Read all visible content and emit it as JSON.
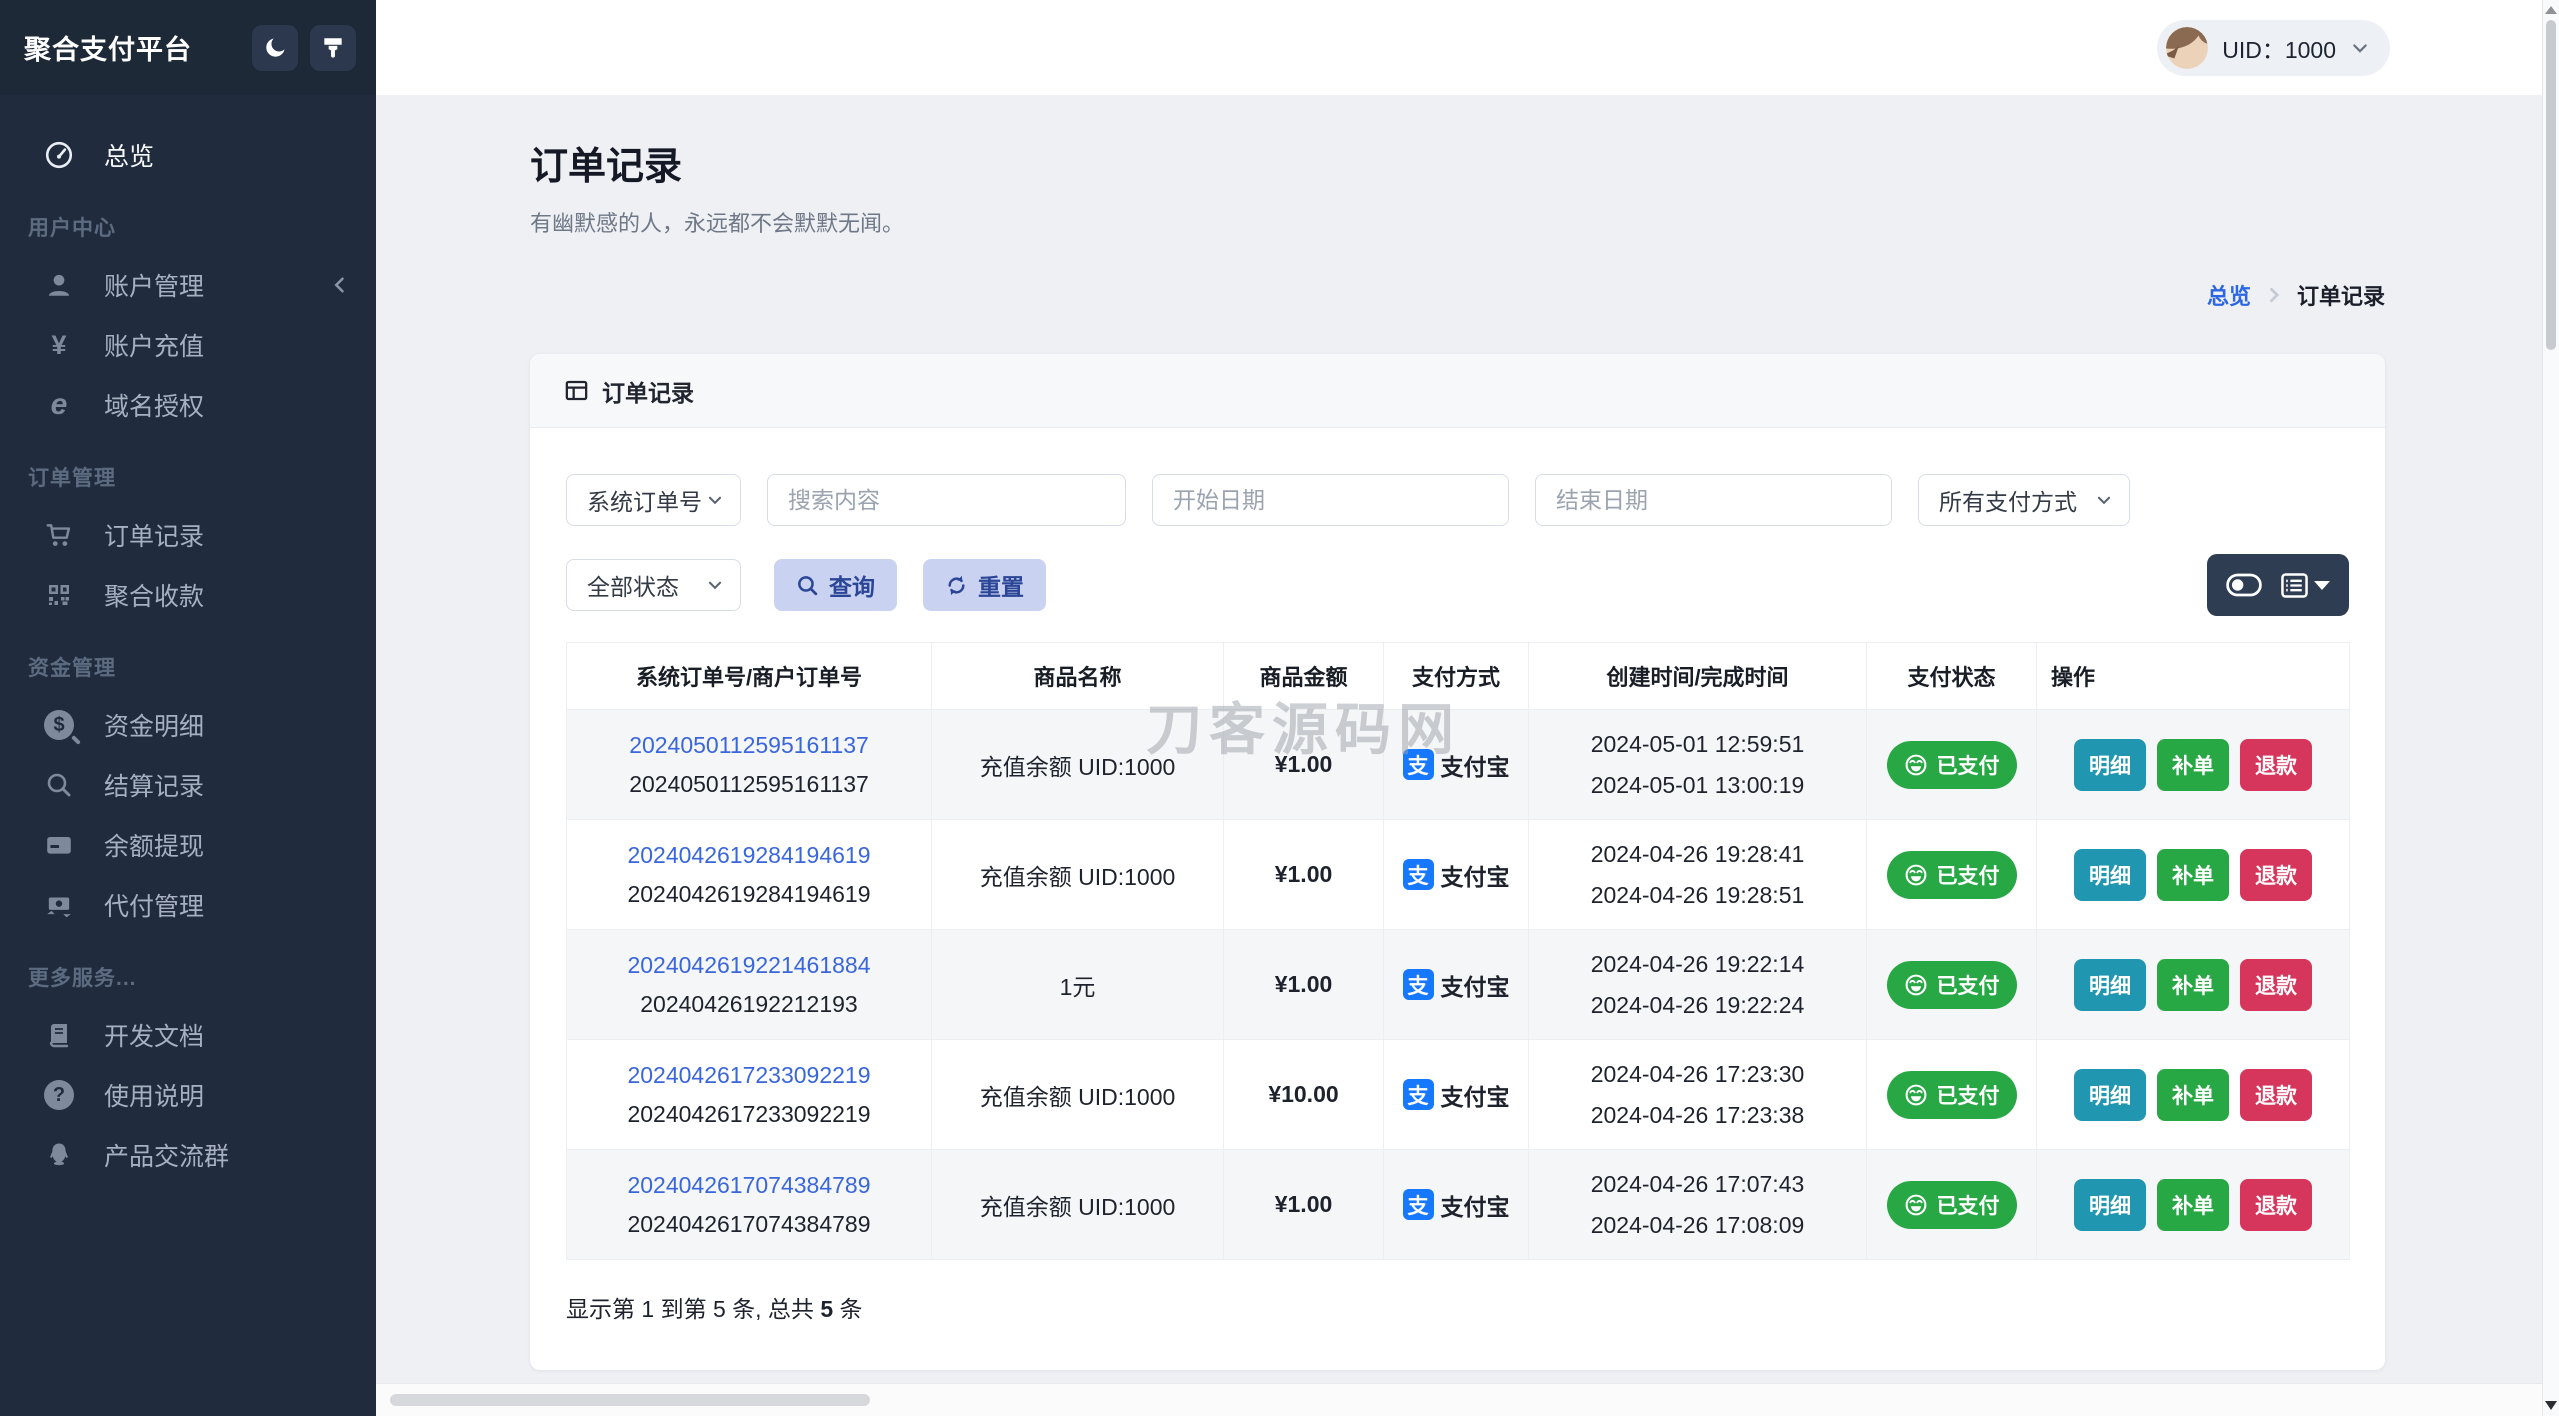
{
  "sidebar": {
    "logo": "聚合支付平台",
    "sections": [
      {
        "label": "",
        "items": [
          {
            "label": "总览",
            "icon": "dashboard-icon",
            "active": true
          }
        ]
      },
      {
        "label": "用户中心",
        "items": [
          {
            "label": "账户管理",
            "icon": "user-icon",
            "has_submenu": true
          },
          {
            "label": "账户充值",
            "icon": "yen-icon"
          },
          {
            "label": "域名授权",
            "icon": "browser-e-icon"
          }
        ]
      },
      {
        "label": "订单管理",
        "items": [
          {
            "label": "订单记录",
            "icon": "cart-icon"
          },
          {
            "label": "聚合收款",
            "icon": "qrcode-icon"
          }
        ]
      },
      {
        "label": "资金管理",
        "items": [
          {
            "label": "资金明细",
            "icon": "coin-search-icon"
          },
          {
            "label": "结算记录",
            "icon": "search-icon"
          },
          {
            "label": "余额提现",
            "icon": "credit-card-icon"
          },
          {
            "label": "代付管理",
            "icon": "money-transfer-icon"
          }
        ]
      },
      {
        "label": "更多服务...",
        "items": [
          {
            "label": "开发文档",
            "icon": "book-icon"
          },
          {
            "label": "使用说明",
            "icon": "question-icon"
          },
          {
            "label": "产品交流群",
            "icon": "qq-icon"
          }
        ]
      }
    ],
    "icon_chars": {
      "yen": "¥",
      "ie": "e",
      "dollar": "$",
      "question": "?"
    }
  },
  "topbar": {
    "uid": "UID：1000"
  },
  "page": {
    "title": "订单记录",
    "subtitle": "有幽默感的人，永远都不会默默无闻。",
    "breadcrumb": {
      "home": "总览",
      "current": "订单记录"
    }
  },
  "card": {
    "title": "订单记录"
  },
  "filters": {
    "order_type": "系统订单号",
    "search_placeholder": "搜索内容",
    "start_date_placeholder": "开始日期",
    "end_date_placeholder": "结束日期",
    "pay_method": "所有支付方式",
    "status": "全部状态",
    "query_label": "查询",
    "reset_label": "重置"
  },
  "table": {
    "headers": [
      "系统订单号/商户订单号",
      "商品名称",
      "商品金额",
      "支付方式",
      "创建时间/完成时间",
      "支付状态",
      "操作"
    ],
    "pay_method": "支付宝",
    "alipay_char": "支",
    "status_paid": "已支付",
    "action_labels": {
      "detail": "明细",
      "reissue": "补单",
      "refund": "退款"
    },
    "rows": [
      {
        "sys_no": "2024050112595161137",
        "merchant_no": "2024050112595161137",
        "product": "充值余额 UID:1000",
        "amount": "¥1.00",
        "created": "2024-05-01 12:59:51",
        "completed": "2024-05-01 13:00:19"
      },
      {
        "sys_no": "2024042619284194619",
        "merchant_no": "2024042619284194619",
        "product": "充值余额 UID:1000",
        "amount": "¥1.00",
        "created": "2024-04-26 19:28:41",
        "completed": "2024-04-26 19:28:51"
      },
      {
        "sys_no": "2024042619221461884",
        "merchant_no": "20240426192212193",
        "product": "1元",
        "amount": "¥1.00",
        "created": "2024-04-26 19:22:14",
        "completed": "2024-04-26 19:22:24"
      },
      {
        "sys_no": "2024042617233092219",
        "merchant_no": "2024042617233092219",
        "product": "充值余额 UID:1000",
        "amount": "¥10.00",
        "created": "2024-04-26 17:23:30",
        "completed": "2024-04-26 17:23:38"
      },
      {
        "sys_no": "2024042617074384789",
        "merchant_no": "2024042617074384789",
        "product": "充值余额 UID:1000",
        "amount": "¥1.00",
        "created": "2024-04-26 17:07:43",
        "completed": "2024-04-26 17:08:09"
      }
    ],
    "pagination": {
      "prefix": "显示第 1 到第 5 条, 总共 ",
      "total": "5",
      "suffix": " 条"
    }
  },
  "watermark": "刀客源码网",
  "colors": {
    "sidebar_bg": "#202c3e",
    "accent_blue": "#2d66e4",
    "link_blue": "#3a66db",
    "success_green": "#28a745",
    "info_teal": "#2196b0",
    "danger_red": "#d6365c",
    "soft_button_bg": "#c9d3f1",
    "soft_button_text": "#2b4597",
    "alipay_blue": "#1677ff"
  }
}
